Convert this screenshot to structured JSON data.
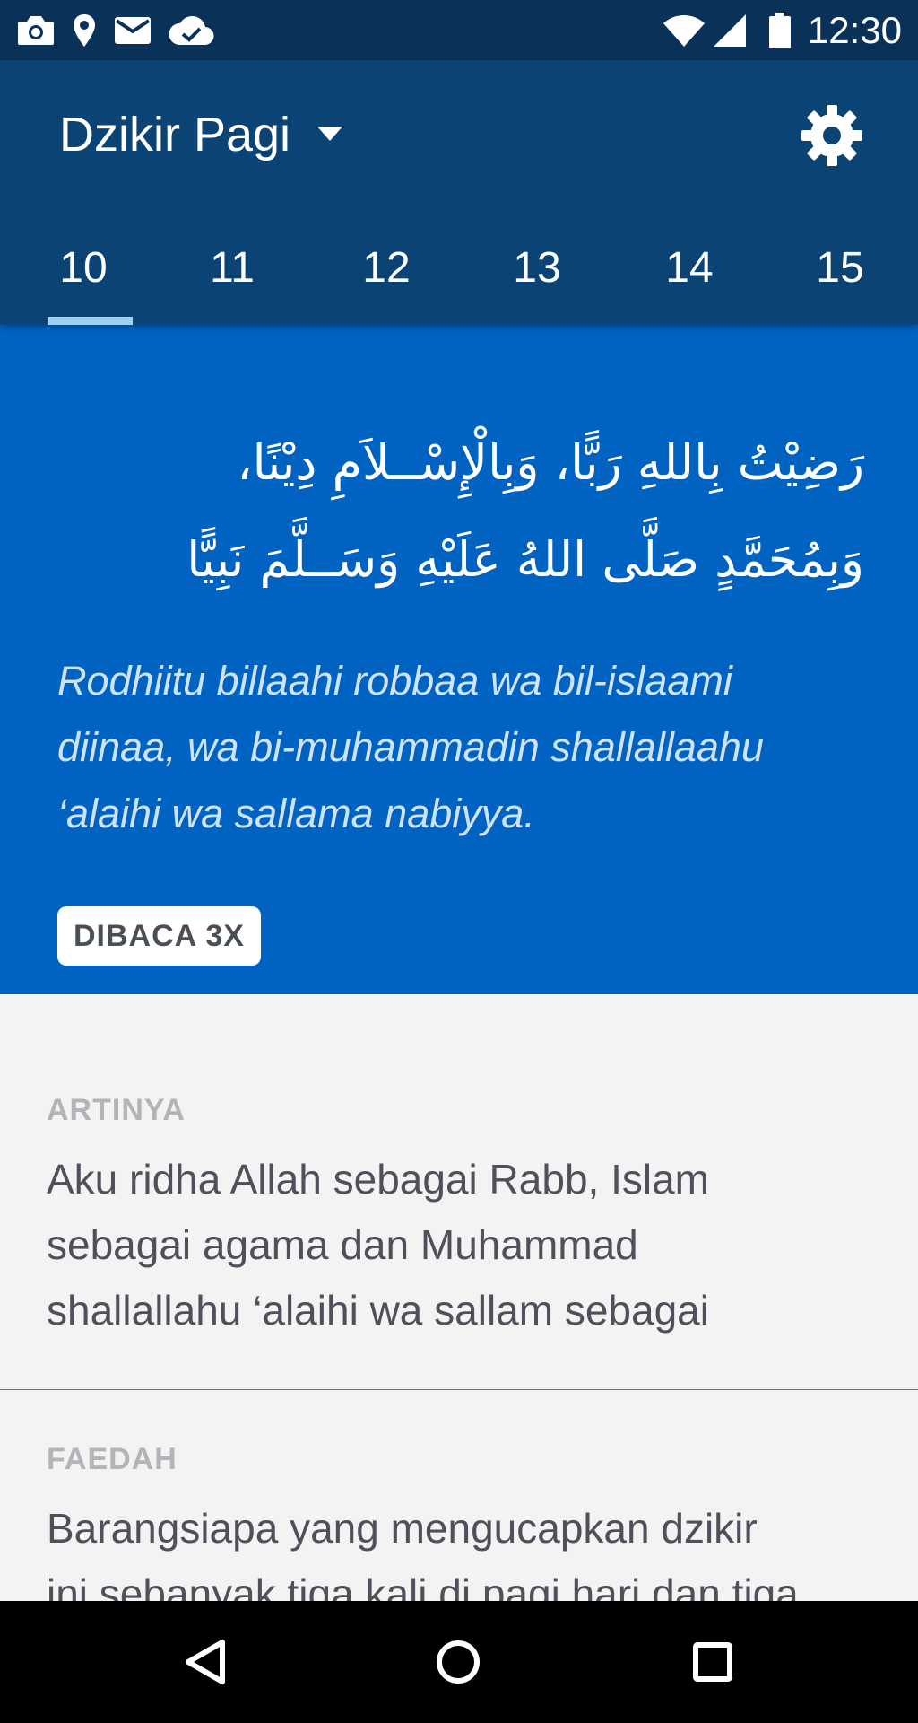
{
  "status_bar": {
    "time": "12:30",
    "icons": [
      "camera-icon",
      "location-icon",
      "mail-icon",
      "cloud-done-icon",
      "wifi-icon",
      "signal-icon",
      "battery-icon"
    ]
  },
  "app_bar": {
    "title": "Dzikir Pagi",
    "dropdown_icon": "caret-down-icon",
    "settings_icon": "gear-icon"
  },
  "tabs": {
    "items": [
      "10",
      "11",
      "12",
      "13",
      "14",
      "15"
    ],
    "selected": "10"
  },
  "dzikir": {
    "arabic_line_1": "رَضِيْتُ بِاللهِ رَبًّا، وَبِالْإِسْــلاَمِ دِيْنًا،",
    "arabic_line_2": "وَبِمُحَمَّدٍ صَلَّى اللهُ عَلَيْهِ وَسَــلَّمَ نَبِيًّا",
    "latin_line_1": "Rodhiitu billaahi robbaa wa bil-islaami",
    "latin_line_2": "diinaa, wa bi-muhammadin shallallaahu",
    "latin_line_3": "‘alaihi wa sallama nabiyya.",
    "badge": "DIBACA 3X"
  },
  "artinya": {
    "label": "ARTINYA",
    "line_1": "Aku ridha Allah sebagai Rabb, Islam",
    "line_2": "sebagai agama dan Muhammad",
    "line_3": "shallallahu ‘alaihi wa sallam sebagai"
  },
  "faedah": {
    "label": "FAEDAH",
    "line_1": "Barangsiapa yang mengucapkan dzikir",
    "line_2": "ini sebanyak tiga kali di pagi hari dan tiga"
  },
  "nav_bar": {
    "icons": [
      "back-icon",
      "home-icon",
      "recents-icon"
    ]
  },
  "colors": {
    "status_bar": "#0a3259",
    "app_bar": "#0b4474",
    "hero": "#0062c1",
    "tab_indicator": "#9fd0ee",
    "content_bg": "#f3f3f4"
  }
}
